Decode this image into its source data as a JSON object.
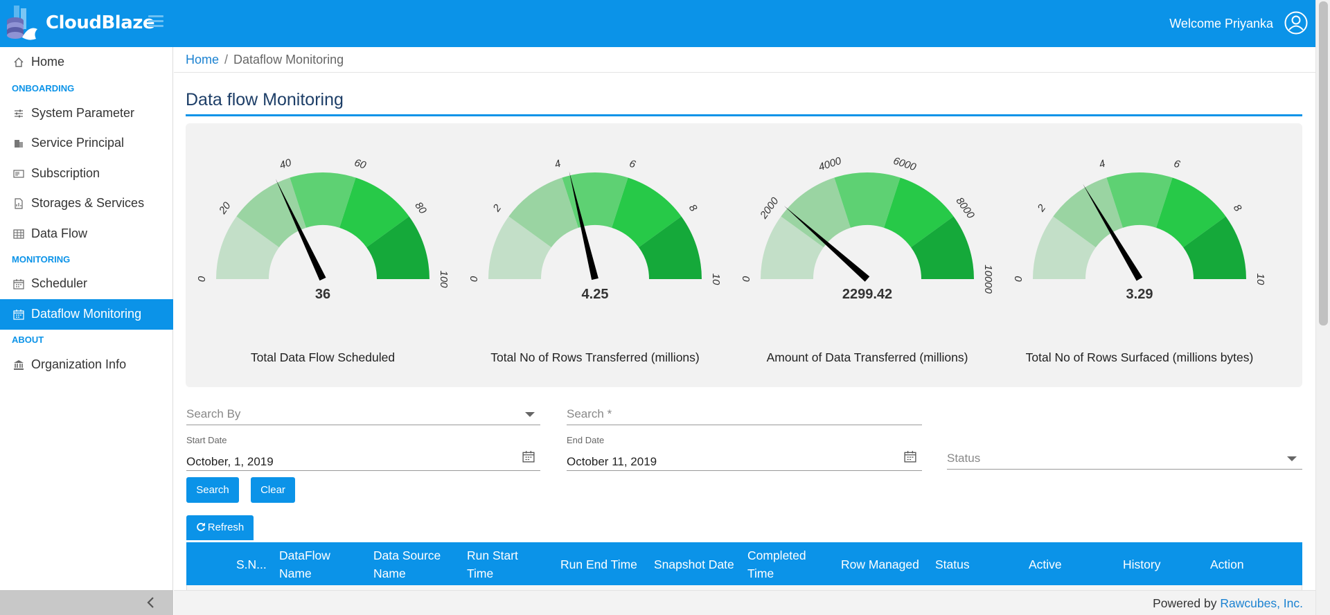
{
  "app": {
    "brand": "CloudBlaze",
    "welcome": "Welcome Priyanka"
  },
  "sidebar": {
    "items": [
      {
        "label": "Home",
        "icon": "home-icon"
      },
      {
        "label": "System Parameter",
        "icon": "sliders-icon"
      },
      {
        "label": "Service Principal",
        "icon": "building-icon"
      },
      {
        "label": "Subscription",
        "icon": "id-card-icon"
      },
      {
        "label": "Storages & Services",
        "icon": "file-chart-icon"
      },
      {
        "label": "Data Flow",
        "icon": "table-icon"
      },
      {
        "label": "Scheduler",
        "icon": "calendar-icon"
      },
      {
        "label": "Dataflow Monitoring",
        "icon": "calendar-icon",
        "active": true
      },
      {
        "label": "Organization Info",
        "icon": "bank-icon"
      }
    ],
    "sections": {
      "onboarding": "ONBOARDING",
      "monitoring": "MONITORING",
      "about": "ABOUT"
    }
  },
  "breadcrumb": {
    "home": "Home",
    "current": "Dataflow Monitoring",
    "separator": "/"
  },
  "page": {
    "title": "Data flow Monitoring"
  },
  "gauges": [
    {
      "label": "Total Data Flow Scheduled",
      "value": 36,
      "display": "36",
      "min": 0,
      "max": 100,
      "ticks": [
        "0",
        "20",
        "40",
        "60",
        "80",
        "100"
      ]
    },
    {
      "label": "Total No of Rows Transferred (millions)",
      "value": 4.25,
      "display": "4.25",
      "min": 0,
      "max": 10,
      "ticks": [
        "0",
        "2",
        "4",
        "6",
        "8",
        "10"
      ]
    },
    {
      "label": "Amount of Data Transferred (millions)",
      "value": 2299.42,
      "display": "2299.42",
      "min": 0,
      "max": 10000,
      "ticks": [
        "0",
        "2000",
        "4000",
        "6000",
        "8000",
        "10000"
      ]
    },
    {
      "label": "Total No of Rows Surfaced (millions bytes)",
      "value": 3.29,
      "display": "3.29",
      "min": 0,
      "max": 10,
      "ticks": [
        "0",
        "2",
        "4",
        "6",
        "8",
        "10"
      ]
    }
  ],
  "gauge_colors": [
    "#c3dfc8",
    "#9ad4a2",
    "#5ed173",
    "#27c948",
    "#15a93a"
  ],
  "filters": {
    "search_by_placeholder": "Search By",
    "search_placeholder": "Search *",
    "start_date_label": "Start Date",
    "start_date_value": "October, 1, 2019",
    "end_date_label": "End Date",
    "end_date_value": "October 11, 2019",
    "status_placeholder": "Status"
  },
  "buttons": {
    "search": "Search",
    "clear": "Clear",
    "refresh": "Refresh"
  },
  "table": {
    "columns": [
      [
        "S.N..."
      ],
      [
        "DataFlow",
        "Name"
      ],
      [
        "Data Source",
        "Name"
      ],
      [
        "Run Start",
        "Time"
      ],
      [
        "Run End Time"
      ],
      [
        "Snapshot Date"
      ],
      [
        "Completed",
        "Time"
      ],
      [
        "Row Managed"
      ],
      [
        "Status"
      ],
      [
        "Active"
      ],
      [
        "History"
      ],
      [
        "Action"
      ]
    ]
  },
  "footer": {
    "prefix": "Powered by ",
    "company": "Rawcubes, Inc."
  },
  "colors": {
    "primary": "#0b93e8",
    "title": "#1d3e67",
    "link": "#1b82d1"
  }
}
